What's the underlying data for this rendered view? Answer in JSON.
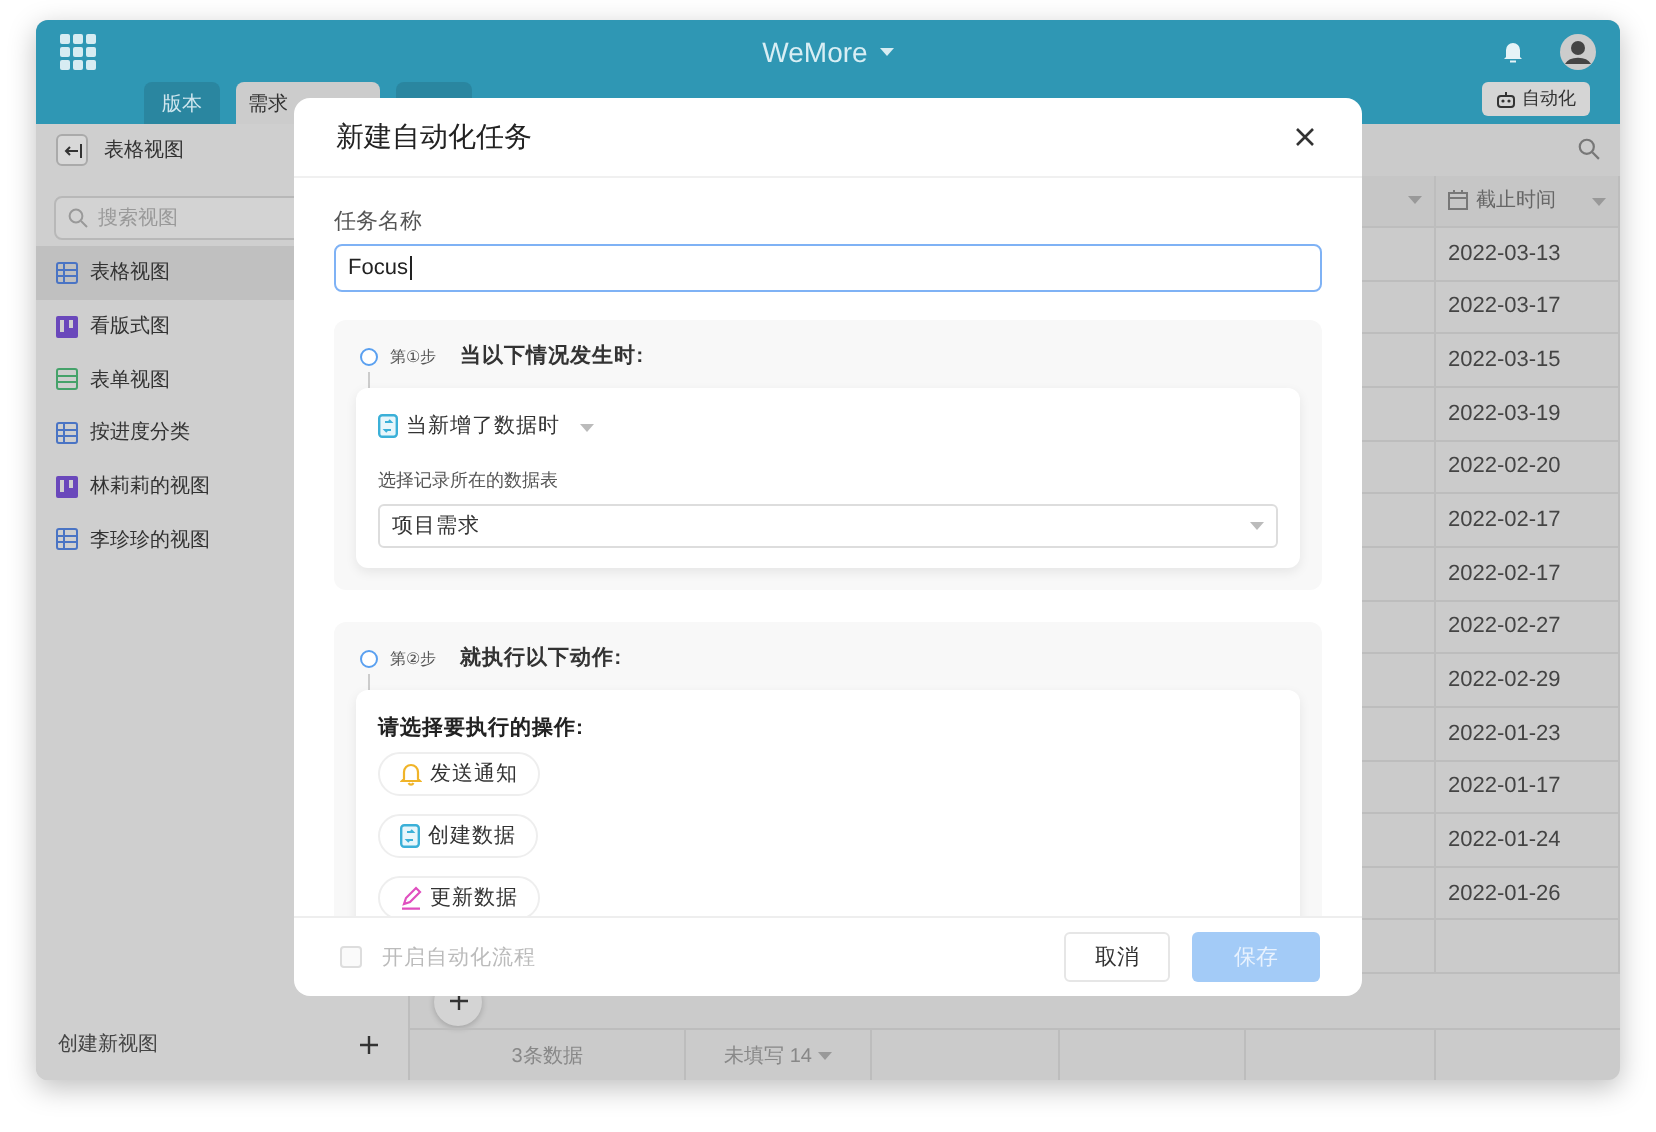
{
  "app": {
    "title": "WeMore",
    "tabs": [
      {
        "label": "版本",
        "selected": false
      },
      {
        "label": "需求",
        "selected": true
      },
      {
        "selected": false
      }
    ],
    "automation_button": "自动化"
  },
  "sidebar": {
    "title": "表格视图",
    "search_placeholder": "搜索视图",
    "items": [
      {
        "label": "表格视图",
        "kind": "grid",
        "selected": true
      },
      {
        "label": "看版式图",
        "kind": "kanban",
        "selected": false
      },
      {
        "label": "表单视图",
        "kind": "form",
        "selected": false
      },
      {
        "label": "按进度分类",
        "kind": "grid",
        "selected": false
      },
      {
        "label": "林莉莉的视图",
        "kind": "kanban",
        "selected": false
      },
      {
        "label": "李珍珍的视图",
        "kind": "grid",
        "selected": false
      }
    ],
    "create_label": "创建新视图"
  },
  "table": {
    "date_column": "截止时间",
    "rows": [
      "2022-03-13",
      "2022-03-17",
      "2022-03-15",
      "2022-03-19",
      "2022-02-20",
      "2022-02-17",
      "2022-02-17",
      "2022-02-27",
      "2022-02-29",
      "2022-01-23",
      "2022-01-17",
      "2022-01-24",
      "2022-01-26"
    ],
    "footer": {
      "count": "3条数据",
      "unfilled": "未填写 14"
    }
  },
  "dialog": {
    "title": "新建自动化任务",
    "name_label": "任务名称",
    "name_value": "Focus",
    "step1": {
      "step": "第①步",
      "heading": "当以下情况发生时:",
      "trigger": "当新增了数据时",
      "table_label": "选择记录所在的数据表",
      "table_value": "项目需求"
    },
    "step2": {
      "step": "第②步",
      "heading": "就执行以下动作:",
      "prompt": "请选择要执行的操作:",
      "actions": [
        {
          "label": "发送通知",
          "kind": "notify"
        },
        {
          "label": "创建数据",
          "kind": "create"
        },
        {
          "label": "更新数据",
          "kind": "update"
        }
      ]
    },
    "enable": {
      "label": "开启自动化流程",
      "checked": false,
      "disabled": true
    },
    "cancel": "取消",
    "save": {
      "label": "保存",
      "disabled": true
    }
  }
}
